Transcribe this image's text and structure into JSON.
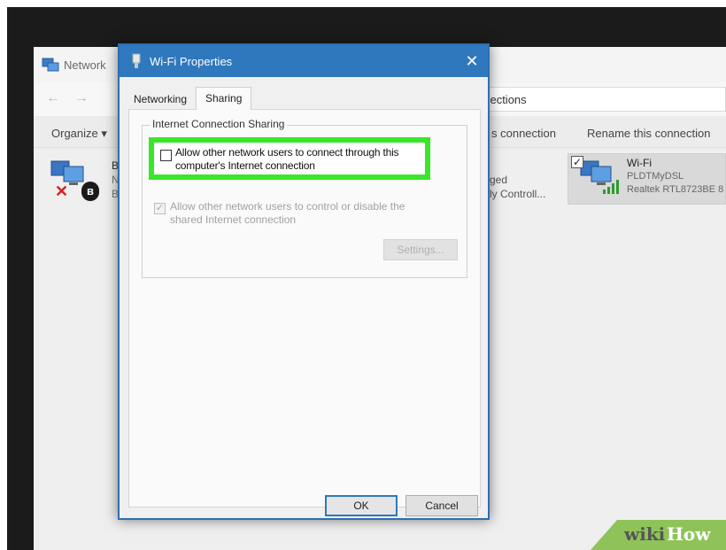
{
  "background_window": {
    "title": "Network",
    "address_text": "nnections",
    "toolbar": {
      "organize": "Organize ▾",
      "diagnose": "s connection",
      "rename": "Rename this connection"
    },
    "bluetooth_item": {
      "line1": "B",
      "line2": "N",
      "line3": "B"
    },
    "middle_item": {
      "line1": "ged",
      "line2": "ly Controll..."
    },
    "wifi_item": {
      "name": "Wi-Fi",
      "network": "PLDTMyDSL",
      "adapter": "Realtek RTL8723BE 8"
    }
  },
  "dialog": {
    "title": "Wi-Fi Properties",
    "tabs": [
      {
        "label": "Networking",
        "selected": false
      },
      {
        "label": "Sharing",
        "selected": true
      }
    ],
    "group_label": "Internet Connection Sharing",
    "share_checkbox": {
      "line1": "Allow other network users to connect through this",
      "line2": "computer's Internet connection",
      "checked": false
    },
    "control_checkbox": {
      "line1": "Allow other network users to control or disable the",
      "line2": "shared Internet connection",
      "checked": true,
      "disabled": true
    },
    "settings_button": "Settings...",
    "ok_button": "OK",
    "cancel_button": "Cancel"
  },
  "watermark": {
    "wiki": "wiki",
    "how": "How"
  },
  "colors": {
    "dialog_title_bar": "#2f78bd",
    "highlight": "#39e62a",
    "watermark_green": "#8fc35a"
  }
}
